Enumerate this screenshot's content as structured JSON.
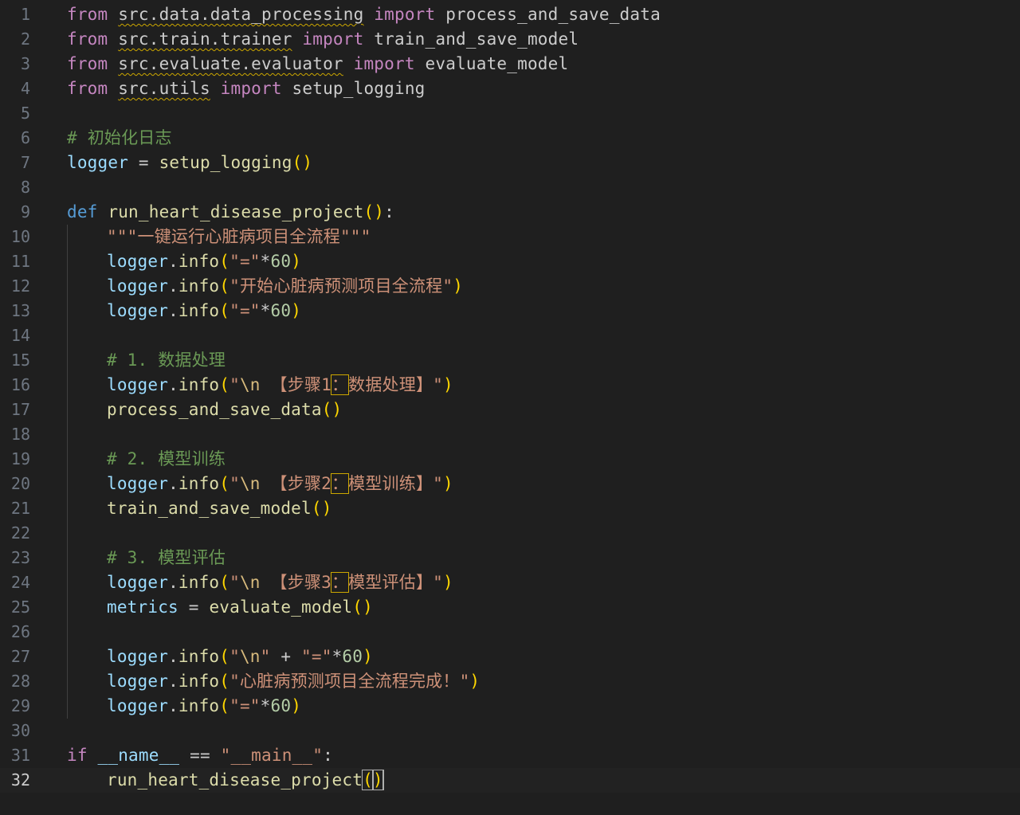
{
  "editor": {
    "current_line": 32,
    "lines": [
      {
        "n": "1",
        "indent": 0,
        "tokens": [
          [
            "kw-ctrl",
            "from"
          ],
          [
            "plain",
            " "
          ],
          [
            "mod",
            "src.data.data_processing"
          ],
          [
            "plain",
            " "
          ],
          [
            "kw-ctrl",
            "import"
          ],
          [
            "plain",
            " process_and_save_data"
          ]
        ]
      },
      {
        "n": "2",
        "indent": 0,
        "tokens": [
          [
            "kw-ctrl",
            "from"
          ],
          [
            "plain",
            " "
          ],
          [
            "mod",
            "src.train.trainer"
          ],
          [
            "plain",
            " "
          ],
          [
            "kw-ctrl",
            "import"
          ],
          [
            "plain",
            " train_and_save_model"
          ]
        ]
      },
      {
        "n": "3",
        "indent": 0,
        "tokens": [
          [
            "kw-ctrl",
            "from"
          ],
          [
            "plain",
            " "
          ],
          [
            "mod",
            "src.evaluate.evaluator"
          ],
          [
            "plain",
            " "
          ],
          [
            "kw-ctrl",
            "import"
          ],
          [
            "plain",
            " evaluate_model"
          ]
        ]
      },
      {
        "n": "4",
        "indent": 0,
        "tokens": [
          [
            "kw-ctrl",
            "from"
          ],
          [
            "plain",
            " "
          ],
          [
            "mod",
            "src.utils"
          ],
          [
            "plain",
            " "
          ],
          [
            "kw-ctrl",
            "import"
          ],
          [
            "plain",
            " setup_logging"
          ]
        ]
      },
      {
        "n": "5",
        "indent": 0,
        "tokens": []
      },
      {
        "n": "6",
        "indent": 0,
        "tokens": [
          [
            "cmt",
            "# "
          ],
          [
            "cmt cjk",
            "初始化日志"
          ]
        ]
      },
      {
        "n": "7",
        "indent": 0,
        "tokens": [
          [
            "var",
            "logger"
          ],
          [
            "plain",
            " = "
          ],
          [
            "fn",
            "setup_logging"
          ],
          [
            "b1",
            "()"
          ]
        ]
      },
      {
        "n": "8",
        "indent": 0,
        "tokens": []
      },
      {
        "n": "9",
        "indent": 0,
        "tokens": [
          [
            "kw-decl",
            "def"
          ],
          [
            "plain",
            " "
          ],
          [
            "fn",
            "run_heart_disease_project"
          ],
          [
            "b1",
            "()"
          ],
          [
            "plain",
            ":"
          ]
        ]
      },
      {
        "n": "10",
        "indent": 1,
        "tokens": [
          [
            "str",
            "\"\"\""
          ],
          [
            "str cjk",
            "一键运行心脏病项目全流程"
          ],
          [
            "str",
            "\"\"\""
          ]
        ]
      },
      {
        "n": "11",
        "indent": 1,
        "tokens": [
          [
            "var",
            "logger"
          ],
          [
            "plain",
            "."
          ],
          [
            "fn",
            "info"
          ],
          [
            "b1",
            "("
          ],
          [
            "str",
            "\"=\""
          ],
          [
            "plain",
            "*"
          ],
          [
            "num",
            "60"
          ],
          [
            "b1",
            ")"
          ]
        ]
      },
      {
        "n": "12",
        "indent": 1,
        "tokens": [
          [
            "var",
            "logger"
          ],
          [
            "plain",
            "."
          ],
          [
            "fn",
            "info"
          ],
          [
            "b1",
            "("
          ],
          [
            "str",
            "\""
          ],
          [
            "str cjk",
            "开始心脏病预测项目全流程"
          ],
          [
            "str",
            "\""
          ],
          [
            "b1",
            ")"
          ]
        ]
      },
      {
        "n": "13",
        "indent": 1,
        "tokens": [
          [
            "var",
            "logger"
          ],
          [
            "plain",
            "."
          ],
          [
            "fn",
            "info"
          ],
          [
            "b1",
            "("
          ],
          [
            "str",
            "\"=\""
          ],
          [
            "plain",
            "*"
          ],
          [
            "num",
            "60"
          ],
          [
            "b1",
            ")"
          ]
        ]
      },
      {
        "n": "14",
        "indent": 1,
        "tokens": []
      },
      {
        "n": "15",
        "indent": 1,
        "tokens": [
          [
            "cmt",
            "# 1. "
          ],
          [
            "cmt cjk",
            "数据处理"
          ]
        ]
      },
      {
        "n": "16",
        "indent": 1,
        "tokens": [
          [
            "var",
            "logger"
          ],
          [
            "plain",
            "."
          ],
          [
            "fn",
            "info"
          ],
          [
            "b1",
            "("
          ],
          [
            "str",
            "\""
          ],
          [
            "esc",
            "\\n"
          ],
          [
            "str",
            " "
          ],
          [
            "str cjk",
            "【步骤"
          ],
          [
            "str",
            "1"
          ],
          [
            "str cjk boxed",
            "："
          ],
          [
            "str cjk",
            "数据处理】"
          ],
          [
            "str",
            "\""
          ],
          [
            "b1",
            ")"
          ]
        ]
      },
      {
        "n": "17",
        "indent": 1,
        "tokens": [
          [
            "fn",
            "process_and_save_data"
          ],
          [
            "b1",
            "()"
          ]
        ]
      },
      {
        "n": "18",
        "indent": 1,
        "tokens": []
      },
      {
        "n": "19",
        "indent": 1,
        "tokens": [
          [
            "cmt",
            "# 2. "
          ],
          [
            "cmt cjk",
            "模型训练"
          ]
        ]
      },
      {
        "n": "20",
        "indent": 1,
        "tokens": [
          [
            "var",
            "logger"
          ],
          [
            "plain",
            "."
          ],
          [
            "fn",
            "info"
          ],
          [
            "b1",
            "("
          ],
          [
            "str",
            "\""
          ],
          [
            "esc",
            "\\n"
          ],
          [
            "str",
            " "
          ],
          [
            "str cjk",
            "【步骤"
          ],
          [
            "str",
            "2"
          ],
          [
            "str cjk boxed",
            "："
          ],
          [
            "str cjk",
            "模型训练】"
          ],
          [
            "str",
            "\""
          ],
          [
            "b1",
            ")"
          ]
        ]
      },
      {
        "n": "21",
        "indent": 1,
        "tokens": [
          [
            "fn",
            "train_and_save_model"
          ],
          [
            "b1",
            "()"
          ]
        ]
      },
      {
        "n": "22",
        "indent": 1,
        "tokens": []
      },
      {
        "n": "23",
        "indent": 1,
        "tokens": [
          [
            "cmt",
            "# 3. "
          ],
          [
            "cmt cjk",
            "模型评估"
          ]
        ]
      },
      {
        "n": "24",
        "indent": 1,
        "tokens": [
          [
            "var",
            "logger"
          ],
          [
            "plain",
            "."
          ],
          [
            "fn",
            "info"
          ],
          [
            "b1",
            "("
          ],
          [
            "str",
            "\""
          ],
          [
            "esc",
            "\\n"
          ],
          [
            "str",
            " "
          ],
          [
            "str cjk",
            "【步骤"
          ],
          [
            "str",
            "3"
          ],
          [
            "str cjk boxed",
            "："
          ],
          [
            "str cjk",
            "模型评估】"
          ],
          [
            "str",
            "\""
          ],
          [
            "b1",
            ")"
          ]
        ]
      },
      {
        "n": "25",
        "indent": 1,
        "tokens": [
          [
            "var",
            "metrics"
          ],
          [
            "plain",
            " = "
          ],
          [
            "fn",
            "evaluate_model"
          ],
          [
            "b1",
            "()"
          ]
        ]
      },
      {
        "n": "26",
        "indent": 1,
        "tokens": []
      },
      {
        "n": "27",
        "indent": 1,
        "tokens": [
          [
            "var",
            "logger"
          ],
          [
            "plain",
            "."
          ],
          [
            "fn",
            "info"
          ],
          [
            "b1",
            "("
          ],
          [
            "str",
            "\""
          ],
          [
            "esc",
            "\\n"
          ],
          [
            "str",
            "\""
          ],
          [
            "plain",
            " + "
          ],
          [
            "str",
            "\"=\""
          ],
          [
            "plain",
            "*"
          ],
          [
            "num",
            "60"
          ],
          [
            "b1",
            ")"
          ]
        ]
      },
      {
        "n": "28",
        "indent": 1,
        "tokens": [
          [
            "var",
            "logger"
          ],
          [
            "plain",
            "."
          ],
          [
            "fn",
            "info"
          ],
          [
            "b1",
            "("
          ],
          [
            "str",
            "\""
          ],
          [
            "str cjk",
            "心脏病预测项目全流程完成！"
          ],
          [
            "str",
            "\""
          ],
          [
            "b1",
            ")"
          ]
        ]
      },
      {
        "n": "29",
        "indent": 1,
        "tokens": [
          [
            "var",
            "logger"
          ],
          [
            "plain",
            "."
          ],
          [
            "fn",
            "info"
          ],
          [
            "b1",
            "("
          ],
          [
            "str",
            "\"=\""
          ],
          [
            "plain",
            "*"
          ],
          [
            "num",
            "60"
          ],
          [
            "b1",
            ")"
          ]
        ]
      },
      {
        "n": "30",
        "indent": 0,
        "tokens": []
      },
      {
        "n": "31",
        "indent": 0,
        "tokens": [
          [
            "kw-ctrl",
            "if"
          ],
          [
            "plain",
            " "
          ],
          [
            "var",
            "__name__"
          ],
          [
            "plain",
            " == "
          ],
          [
            "str",
            "\"__main__\""
          ],
          [
            "plain",
            ":"
          ]
        ]
      },
      {
        "n": "32",
        "indent": 1,
        "tokens": [
          [
            "fn",
            "run_heart_disease_project"
          ],
          [
            "b1 bracket-match",
            "("
          ],
          [
            "b1 bracket-match",
            ")"
          ]
        ]
      }
    ]
  }
}
